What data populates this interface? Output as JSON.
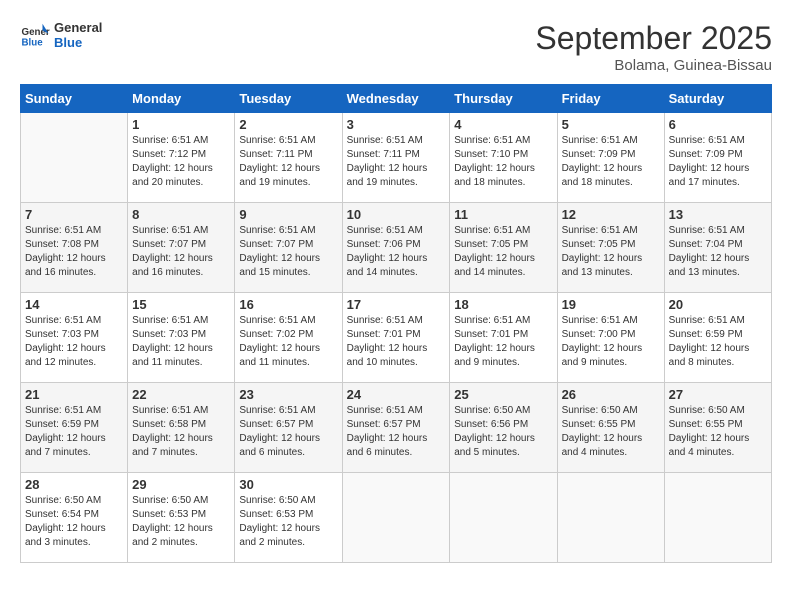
{
  "logo": {
    "line1": "General",
    "line2": "Blue"
  },
  "title": "September 2025",
  "subtitle": "Bolama, Guinea-Bissau",
  "days_of_week": [
    "Sunday",
    "Monday",
    "Tuesday",
    "Wednesday",
    "Thursday",
    "Friday",
    "Saturday"
  ],
  "weeks": [
    [
      {
        "day": "",
        "info": ""
      },
      {
        "day": "1",
        "info": "Sunrise: 6:51 AM\nSunset: 7:12 PM\nDaylight: 12 hours\nand 20 minutes."
      },
      {
        "day": "2",
        "info": "Sunrise: 6:51 AM\nSunset: 7:11 PM\nDaylight: 12 hours\nand 19 minutes."
      },
      {
        "day": "3",
        "info": "Sunrise: 6:51 AM\nSunset: 7:11 PM\nDaylight: 12 hours\nand 19 minutes."
      },
      {
        "day": "4",
        "info": "Sunrise: 6:51 AM\nSunset: 7:10 PM\nDaylight: 12 hours\nand 18 minutes."
      },
      {
        "day": "5",
        "info": "Sunrise: 6:51 AM\nSunset: 7:09 PM\nDaylight: 12 hours\nand 18 minutes."
      },
      {
        "day": "6",
        "info": "Sunrise: 6:51 AM\nSunset: 7:09 PM\nDaylight: 12 hours\nand 17 minutes."
      }
    ],
    [
      {
        "day": "7",
        "info": "Sunrise: 6:51 AM\nSunset: 7:08 PM\nDaylight: 12 hours\nand 16 minutes."
      },
      {
        "day": "8",
        "info": "Sunrise: 6:51 AM\nSunset: 7:07 PM\nDaylight: 12 hours\nand 16 minutes."
      },
      {
        "day": "9",
        "info": "Sunrise: 6:51 AM\nSunset: 7:07 PM\nDaylight: 12 hours\nand 15 minutes."
      },
      {
        "day": "10",
        "info": "Sunrise: 6:51 AM\nSunset: 7:06 PM\nDaylight: 12 hours\nand 14 minutes."
      },
      {
        "day": "11",
        "info": "Sunrise: 6:51 AM\nSunset: 7:05 PM\nDaylight: 12 hours\nand 14 minutes."
      },
      {
        "day": "12",
        "info": "Sunrise: 6:51 AM\nSunset: 7:05 PM\nDaylight: 12 hours\nand 13 minutes."
      },
      {
        "day": "13",
        "info": "Sunrise: 6:51 AM\nSunset: 7:04 PM\nDaylight: 12 hours\nand 13 minutes."
      }
    ],
    [
      {
        "day": "14",
        "info": "Sunrise: 6:51 AM\nSunset: 7:03 PM\nDaylight: 12 hours\nand 12 minutes."
      },
      {
        "day": "15",
        "info": "Sunrise: 6:51 AM\nSunset: 7:03 PM\nDaylight: 12 hours\nand 11 minutes."
      },
      {
        "day": "16",
        "info": "Sunrise: 6:51 AM\nSunset: 7:02 PM\nDaylight: 12 hours\nand 11 minutes."
      },
      {
        "day": "17",
        "info": "Sunrise: 6:51 AM\nSunset: 7:01 PM\nDaylight: 12 hours\nand 10 minutes."
      },
      {
        "day": "18",
        "info": "Sunrise: 6:51 AM\nSunset: 7:01 PM\nDaylight: 12 hours\nand 9 minutes."
      },
      {
        "day": "19",
        "info": "Sunrise: 6:51 AM\nSunset: 7:00 PM\nDaylight: 12 hours\nand 9 minutes."
      },
      {
        "day": "20",
        "info": "Sunrise: 6:51 AM\nSunset: 6:59 PM\nDaylight: 12 hours\nand 8 minutes."
      }
    ],
    [
      {
        "day": "21",
        "info": "Sunrise: 6:51 AM\nSunset: 6:59 PM\nDaylight: 12 hours\nand 7 minutes."
      },
      {
        "day": "22",
        "info": "Sunrise: 6:51 AM\nSunset: 6:58 PM\nDaylight: 12 hours\nand 7 minutes."
      },
      {
        "day": "23",
        "info": "Sunrise: 6:51 AM\nSunset: 6:57 PM\nDaylight: 12 hours\nand 6 minutes."
      },
      {
        "day": "24",
        "info": "Sunrise: 6:51 AM\nSunset: 6:57 PM\nDaylight: 12 hours\nand 6 minutes."
      },
      {
        "day": "25",
        "info": "Sunrise: 6:50 AM\nSunset: 6:56 PM\nDaylight: 12 hours\nand 5 minutes."
      },
      {
        "day": "26",
        "info": "Sunrise: 6:50 AM\nSunset: 6:55 PM\nDaylight: 12 hours\nand 4 minutes."
      },
      {
        "day": "27",
        "info": "Sunrise: 6:50 AM\nSunset: 6:55 PM\nDaylight: 12 hours\nand 4 minutes."
      }
    ],
    [
      {
        "day": "28",
        "info": "Sunrise: 6:50 AM\nSunset: 6:54 PM\nDaylight: 12 hours\nand 3 minutes."
      },
      {
        "day": "29",
        "info": "Sunrise: 6:50 AM\nSunset: 6:53 PM\nDaylight: 12 hours\nand 2 minutes."
      },
      {
        "day": "30",
        "info": "Sunrise: 6:50 AM\nSunset: 6:53 PM\nDaylight: 12 hours\nand 2 minutes."
      },
      {
        "day": "",
        "info": ""
      },
      {
        "day": "",
        "info": ""
      },
      {
        "day": "",
        "info": ""
      },
      {
        "day": "",
        "info": ""
      }
    ]
  ]
}
